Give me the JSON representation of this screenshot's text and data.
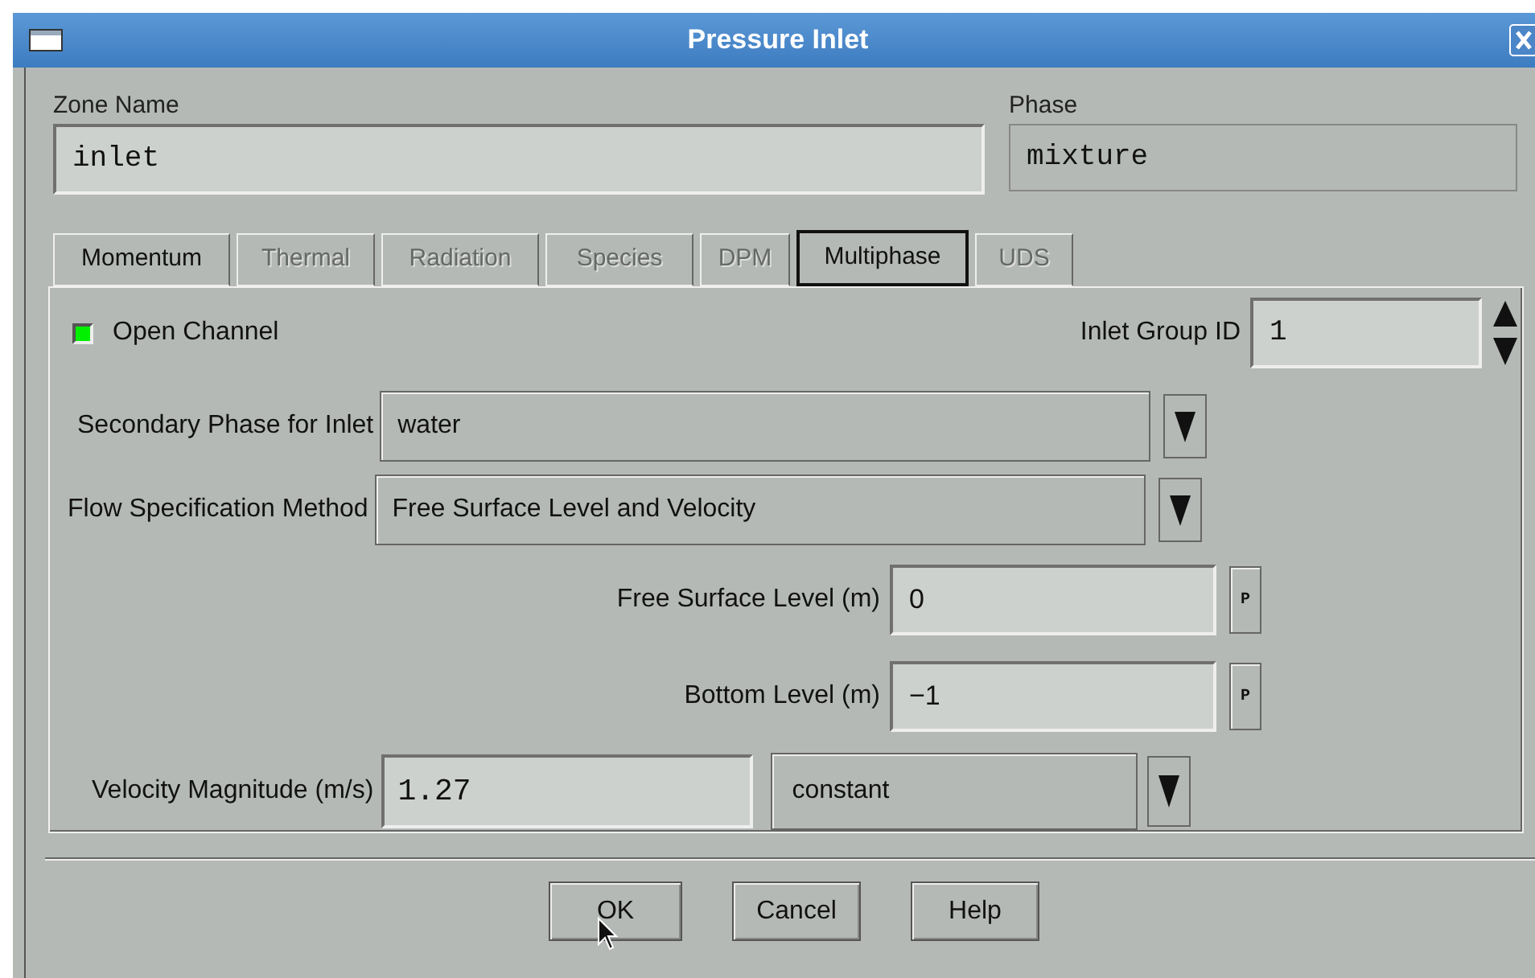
{
  "window": {
    "title": "Pressure Inlet"
  },
  "zone_name": {
    "label": "Zone Name",
    "value": "inlet"
  },
  "phase": {
    "label": "Phase",
    "value": "mixture"
  },
  "tabs": [
    {
      "label": "Momentum",
      "selected": false,
      "disabled": false
    },
    {
      "label": "Thermal",
      "selected": false,
      "disabled": true
    },
    {
      "label": "Radiation",
      "selected": false,
      "disabled": true
    },
    {
      "label": "Species",
      "selected": false,
      "disabled": true
    },
    {
      "label": "DPM",
      "selected": false,
      "disabled": true
    },
    {
      "label": "Multiphase",
      "selected": true,
      "disabled": false
    },
    {
      "label": "UDS",
      "selected": false,
      "disabled": true
    }
  ],
  "open_channel": {
    "label": "Open Channel",
    "checked": true
  },
  "inlet_group_id": {
    "label": "Inlet Group ID",
    "value": "1"
  },
  "secondary_phase": {
    "label": "Secondary Phase for Inlet",
    "value": "water"
  },
  "flow_specification_method": {
    "label": "Flow Specification Method",
    "value": "Free Surface Level and Velocity"
  },
  "free_surface_level": {
    "label": "Free Surface Level (m)",
    "value": "0",
    "button": "P"
  },
  "bottom_level": {
    "label": "Bottom Level (m)",
    "value": "−1",
    "button": "P"
  },
  "velocity_magnitude": {
    "label": "Velocity Magnitude (m/s)",
    "value": "1.27",
    "method": "constant"
  },
  "buttons": [
    "OK",
    "Cancel",
    "Help"
  ]
}
